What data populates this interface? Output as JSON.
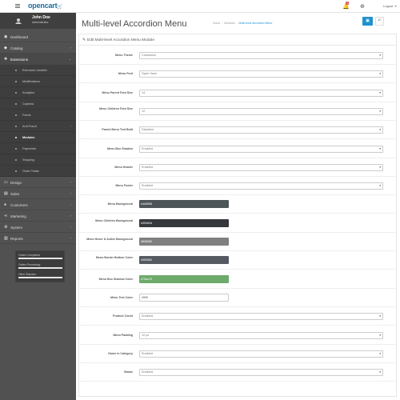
{
  "header": {
    "logo": "opencart",
    "notification_count": "3",
    "logout_label": "Logout"
  },
  "profile": {
    "name": "John Doe",
    "role": "Administrator"
  },
  "sidebar": {
    "items": [
      {
        "label": "Dashboard",
        "icon": "dashboard-icon"
      },
      {
        "label": "Catalog",
        "icon": "tag-icon"
      },
      {
        "label": "Extensions",
        "icon": "puzzle-icon"
      },
      {
        "label": "Design",
        "icon": "desktop-icon"
      },
      {
        "label": "Sales",
        "icon": "cart-icon"
      },
      {
        "label": "Customers",
        "icon": "user-icon"
      },
      {
        "label": "Marketing",
        "icon": "share-icon"
      },
      {
        "label": "System",
        "icon": "cog-icon"
      },
      {
        "label": "Reports",
        "icon": "bar-chart-icon"
      }
    ],
    "sub_items": [
      {
        "label": "Extension Installer"
      },
      {
        "label": "Modifications"
      },
      {
        "label": "Analytics"
      },
      {
        "label": "Captcha"
      },
      {
        "label": "Feeds"
      },
      {
        "label": "Anti-Fraud"
      },
      {
        "label": "Modules"
      },
      {
        "label": "Payments"
      },
      {
        "label": "Shipping"
      },
      {
        "label": "Order Totals"
      }
    ],
    "stats": [
      {
        "label": "Orders Completed",
        "value": 1.0
      },
      {
        "label": "Orders Processing",
        "value": 1.0
      },
      {
        "label": "Other Statuses",
        "value": 1.0
      }
    ]
  },
  "page": {
    "title": "Multi-level Accordion Menu",
    "breadcrumb": [
      "Home",
      "Modules",
      "Multi-level Accordion Menu"
    ],
    "panel_title": "Edit Multi-level Accordion Menu Module"
  },
  "form": {
    "rows": [
      {
        "label": "Menu Theme",
        "value": "Customize",
        "type": "select"
      },
      {
        "label": "Menu Font",
        "value": "Open Sans",
        "type": "select"
      },
      {
        "label": "Menu Parent Font Size",
        "value": "14",
        "type": "select"
      },
      {
        "label": "Menu Children Font Size",
        "value": "12",
        "type": "select"
      },
      {
        "label": "Parent Menu Text Bold",
        "value": "Disabled",
        "type": "select"
      },
      {
        "label": "Menu Box Shadow",
        "value": "Enabled",
        "type": "select"
      },
      {
        "label": "Menu Header",
        "value": "Enabled",
        "type": "select"
      },
      {
        "label": "Menu Footer",
        "value": "Enabled",
        "type": "select"
      },
      {
        "label": "Menu Background",
        "value": "#4d5558",
        "type": "color",
        "color": "#4d5558"
      },
      {
        "label": "Menu Children Background",
        "value": "#35383d",
        "type": "color",
        "color": "#35383d"
      },
      {
        "label": "Menu Hover & Active Background",
        "value": "#808080",
        "type": "color",
        "color": "#808080"
      },
      {
        "label": "Menu Border Bottom Color",
        "value": "#555960",
        "type": "color",
        "color": "#555960"
      },
      {
        "label": "Menu Box Shadow Color",
        "value": "#79ac78",
        "type": "color",
        "color": "#6eaa6c"
      },
      {
        "label": "Menu Text Color",
        "value": "#ffffff",
        "type": "color-light",
        "color": "#ffffff"
      },
      {
        "label": "Product Count",
        "value": "Enabled",
        "type": "select"
      },
      {
        "label": "Menu Padding",
        "value": "12 px",
        "type": "select"
      },
      {
        "label": "Home in Category",
        "value": "Enabled",
        "type": "select"
      },
      {
        "label": "Status",
        "value": "Enabled",
        "type": "select"
      }
    ]
  },
  "colors": {
    "accent": "#1e91cf",
    "sidebar": "#515151",
    "sidebar_dark": "#3e3e3e"
  }
}
